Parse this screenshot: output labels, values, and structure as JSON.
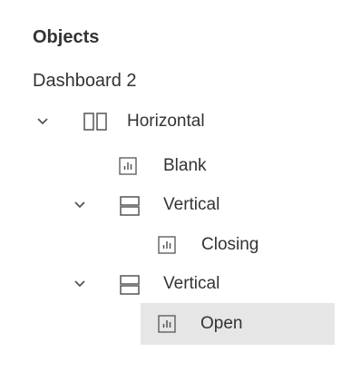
{
  "panel": {
    "title": "Objects",
    "dashboard": "Dashboard 2"
  },
  "tree": {
    "items": [
      {
        "label": "Horizontal",
        "type": "horizontal",
        "expanded": true
      },
      {
        "label": "Blank",
        "type": "sheet"
      },
      {
        "label": "Vertical",
        "type": "vertical",
        "expanded": true
      },
      {
        "label": "Closing",
        "type": "sheet"
      },
      {
        "label": "Vertical",
        "type": "vertical",
        "expanded": true
      },
      {
        "label": "Open",
        "type": "sheet",
        "selected": true
      }
    ]
  },
  "colors": {
    "text": "#333333",
    "icon": "#555555",
    "selected_bg": "#e6e6e6"
  },
  "icons": {
    "chevron": "chevron-down-icon",
    "horizontal": "horizontal-container-icon",
    "vertical": "vertical-container-icon",
    "sheet": "sheet-icon"
  }
}
